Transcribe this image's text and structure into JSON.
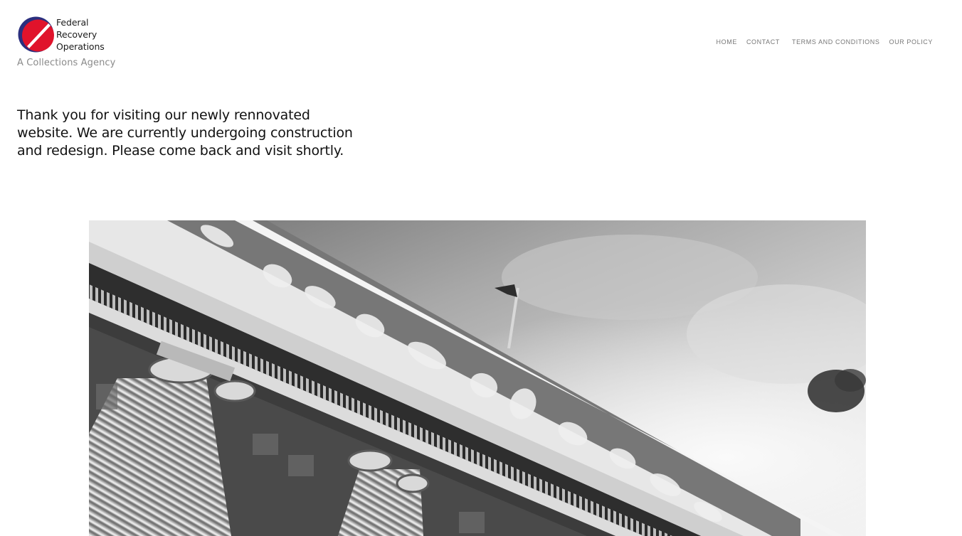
{
  "brand": {
    "name_line1": "Federal",
    "name_line2": "Recovery",
    "name_line3": "Operations",
    "tagline": "A Collections Agency",
    "logo_icon": "circle-slash-logo-icon",
    "colors": {
      "ring": "#2b2f7e",
      "disc": "#e0132b",
      "slash": "#ffffff"
    }
  },
  "nav": {
    "items": [
      {
        "label": "HOME"
      },
      {
        "label": "CONTACT"
      },
      {
        "label": "TERMS AND CONDITIONS"
      },
      {
        "label": "OUR POLICY"
      }
    ]
  },
  "main": {
    "notice": "Thank you for visiting our newly rennovated website. We are currently undergoing construction and redesign. Please come back and visit shortly."
  },
  "hero": {
    "subject": "black-and-white classical building facade with columns and pediment statues",
    "icon": "courthouse-photo"
  }
}
